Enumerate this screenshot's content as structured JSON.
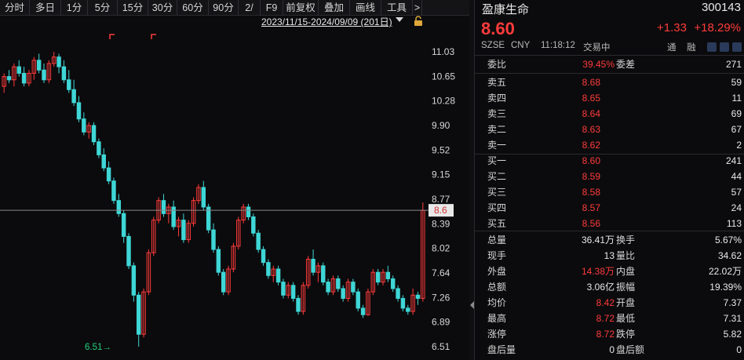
{
  "toolbar": {
    "items": [
      "分时",
      "多日",
      "1分",
      "5分",
      "15分",
      "30分",
      "60分",
      "90分",
      "2/",
      "F9",
      "前复权",
      "叠加",
      "画线",
      "工具",
      ">"
    ]
  },
  "range_label": "2023/11/15-2024/09/09 (201日)",
  "chart": {
    "price_axis": [
      "11.03",
      "10.65",
      "10.28",
      "9.90",
      "9.52",
      "9.15",
      "8.77",
      "8.39",
      "8.02",
      "7.64",
      "7.26",
      "6.89",
      "6.51"
    ],
    "current_marker": "8.6",
    "low_annotation": "6.51→",
    "colors": {
      "up": "#ff3b3b",
      "down": "#3fd6d6",
      "axis": "#d6d6d6"
    }
  },
  "chart_data": {
    "type": "candlestick",
    "ylim": [
      6.51,
      11.03
    ],
    "current_price": 8.6,
    "low": 6.51,
    "candles": [
      [
        10.5,
        10.7,
        10.4,
        10.65
      ],
      [
        10.65,
        10.75,
        10.55,
        10.6
      ],
      [
        10.6,
        10.85,
        10.5,
        10.8
      ],
      [
        10.8,
        10.9,
        10.65,
        10.7
      ],
      [
        10.7,
        10.8,
        10.5,
        10.55
      ],
      [
        10.55,
        10.75,
        10.5,
        10.7
      ],
      [
        10.7,
        10.95,
        10.6,
        10.9
      ],
      [
        10.9,
        11.0,
        10.7,
        10.75
      ],
      [
        10.75,
        10.85,
        10.55,
        10.6
      ],
      [
        10.6,
        10.9,
        10.55,
        10.85
      ],
      [
        10.85,
        11.03,
        10.8,
        10.95
      ],
      [
        10.95,
        11.0,
        10.7,
        10.8
      ],
      [
        10.8,
        10.9,
        10.55,
        10.6
      ],
      [
        10.6,
        10.75,
        10.4,
        10.45
      ],
      [
        10.45,
        10.6,
        10.2,
        10.25
      ],
      [
        10.25,
        10.35,
        9.95,
        10.0
      ],
      [
        10.0,
        10.1,
        9.75,
        9.8
      ],
      [
        9.8,
        9.95,
        9.7,
        9.9
      ],
      [
        9.9,
        9.95,
        9.6,
        9.65
      ],
      [
        9.65,
        9.7,
        9.4,
        9.45
      ],
      [
        9.45,
        9.55,
        9.2,
        9.25
      ],
      [
        9.25,
        9.35,
        9.0,
        9.05
      ],
      [
        9.05,
        9.1,
        8.7,
        8.75
      ],
      [
        8.75,
        8.85,
        8.5,
        8.55
      ],
      [
        8.55,
        8.6,
        8.1,
        8.2
      ],
      [
        8.2,
        8.25,
        7.7,
        7.75
      ],
      [
        7.75,
        7.8,
        7.2,
        7.3
      ],
      [
        7.3,
        7.35,
        6.51,
        6.7
      ],
      [
        6.7,
        7.4,
        6.65,
        7.35
      ],
      [
        7.35,
        8.0,
        7.3,
        7.95
      ],
      [
        7.95,
        8.5,
        7.9,
        8.45
      ],
      [
        8.45,
        8.8,
        8.4,
        8.75
      ],
      [
        8.75,
        8.85,
        8.5,
        8.55
      ],
      [
        8.55,
        8.7,
        8.4,
        8.65
      ],
      [
        8.65,
        8.75,
        8.3,
        8.35
      ],
      [
        8.35,
        8.5,
        8.2,
        8.45
      ],
      [
        8.45,
        8.55,
        8.1,
        8.15
      ],
      [
        8.15,
        8.45,
        8.1,
        8.4
      ],
      [
        8.4,
        8.8,
        8.35,
        8.75
      ],
      [
        8.75,
        9.0,
        8.7,
        8.95
      ],
      [
        8.95,
        9.05,
        8.6,
        8.65
      ],
      [
        8.65,
        8.7,
        8.25,
        8.3
      ],
      [
        8.3,
        8.4,
        7.95,
        8.0
      ],
      [
        8.0,
        8.05,
        7.6,
        7.65
      ],
      [
        7.65,
        7.7,
        7.3,
        7.35
      ],
      [
        7.35,
        7.75,
        7.3,
        7.7
      ],
      [
        7.7,
        8.1,
        7.65,
        8.05
      ],
      [
        8.05,
        8.5,
        8.0,
        8.45
      ],
      [
        8.45,
        8.7,
        8.4,
        8.65
      ],
      [
        8.65,
        8.7,
        8.45,
        8.5
      ],
      [
        8.5,
        8.55,
        8.2,
        8.25
      ],
      [
        8.25,
        8.3,
        7.95,
        8.0
      ],
      [
        8.0,
        8.05,
        7.75,
        7.8
      ],
      [
        7.8,
        7.85,
        7.55,
        7.6
      ],
      [
        7.6,
        7.75,
        7.5,
        7.7
      ],
      [
        7.7,
        7.75,
        7.45,
        7.5
      ],
      [
        7.5,
        7.55,
        7.25,
        7.3
      ],
      [
        7.3,
        7.5,
        7.25,
        7.45
      ],
      [
        7.45,
        7.5,
        7.2,
        7.25
      ],
      [
        7.25,
        7.3,
        7.0,
        7.05
      ],
      [
        7.05,
        7.5,
        7.0,
        7.45
      ],
      [
        7.45,
        7.9,
        7.4,
        7.85
      ],
      [
        7.85,
        8.0,
        7.6,
        7.65
      ],
      [
        7.65,
        7.8,
        7.5,
        7.75
      ],
      [
        7.75,
        7.8,
        7.45,
        7.5
      ],
      [
        7.5,
        7.55,
        7.3,
        7.35
      ],
      [
        7.35,
        7.6,
        7.3,
        7.55
      ],
      [
        7.55,
        7.6,
        7.35,
        7.4
      ],
      [
        7.4,
        7.45,
        7.2,
        7.25
      ],
      [
        7.25,
        7.55,
        7.2,
        7.5
      ],
      [
        7.5,
        7.55,
        7.3,
        7.35
      ],
      [
        7.35,
        7.4,
        7.05,
        7.1
      ],
      [
        7.1,
        7.15,
        6.95,
        7.0
      ],
      [
        7.0,
        7.4,
        6.98,
        7.35
      ],
      [
        7.35,
        7.7,
        7.3,
        7.65
      ],
      [
        7.65,
        7.7,
        7.45,
        7.5
      ],
      [
        7.5,
        7.7,
        7.45,
        7.65
      ],
      [
        7.65,
        7.75,
        7.5,
        7.55
      ],
      [
        7.55,
        7.6,
        7.35,
        7.4
      ],
      [
        7.4,
        7.45,
        7.2,
        7.25
      ],
      [
        7.25,
        7.3,
        7.05,
        7.1
      ],
      [
        7.1,
        7.15,
        7.0,
        7.05
      ],
      [
        7.05,
        7.4,
        7.0,
        7.3
      ],
      [
        7.3,
        7.35,
        7.15,
        7.25
      ],
      [
        7.25,
        8.72,
        7.2,
        8.6
      ]
    ]
  },
  "panel": {
    "name": "盈康生命",
    "code": "300143",
    "price": "8.60",
    "change": "+1.33",
    "change_pct": "+18.29%",
    "market": "SZSE",
    "currency": "CNY",
    "time": "11:18:12",
    "status": "交易中",
    "tong": "通",
    "rong": "融",
    "weibi_label": "委比",
    "weibi": "39.45%",
    "weicha_label": "委差",
    "weicha": "271",
    "asks": [
      {
        "label": "卖五",
        "price": "8.68",
        "vol": "59"
      },
      {
        "label": "卖四",
        "price": "8.65",
        "vol": "11"
      },
      {
        "label": "卖三",
        "price": "8.64",
        "vol": "69"
      },
      {
        "label": "卖二",
        "price": "8.63",
        "vol": "67"
      },
      {
        "label": "卖一",
        "price": "8.62",
        "vol": "2"
      }
    ],
    "bids": [
      {
        "label": "买一",
        "price": "8.60",
        "vol": "241"
      },
      {
        "label": "买二",
        "price": "8.59",
        "vol": "44"
      },
      {
        "label": "买三",
        "price": "8.58",
        "vol": "57"
      },
      {
        "label": "买四",
        "price": "8.57",
        "vol": "24"
      },
      {
        "label": "买五",
        "price": "8.56",
        "vol": "113"
      }
    ],
    "stats": [
      {
        "l1": "总量",
        "v1": "36.41万",
        "c1": "white",
        "l2": "换手",
        "v2": "5.67%",
        "c2": "white"
      },
      {
        "l1": "现手",
        "v1": "13",
        "c1": "white",
        "l2": "量比",
        "v2": "34.62",
        "c2": "white"
      },
      {
        "l1": "外盘",
        "v1": "14.38万",
        "c1": "red",
        "l2": "内盘",
        "v2": "22.02万",
        "c2": "green"
      },
      {
        "l1": "总额",
        "v1": "3.06亿",
        "c1": "white",
        "l2": "振幅",
        "v2": "19.39%",
        "c2": "white"
      },
      {
        "l1": "均价",
        "v1": "8.42",
        "c1": "red",
        "l2": "开盘",
        "v2": "7.37",
        "c2": "red"
      },
      {
        "l1": "最高",
        "v1": "8.72",
        "c1": "red",
        "l2": "最低",
        "v2": "7.31",
        "c2": "red"
      },
      {
        "l1": "涨停",
        "v1": "8.72",
        "c1": "red",
        "l2": "跌停",
        "v2": "5.82",
        "c2": "green"
      },
      {
        "l1": "盘后量",
        "v1": "0",
        "c1": "white",
        "l2": "盘后额",
        "v2": "0",
        "c2": "white"
      }
    ]
  }
}
